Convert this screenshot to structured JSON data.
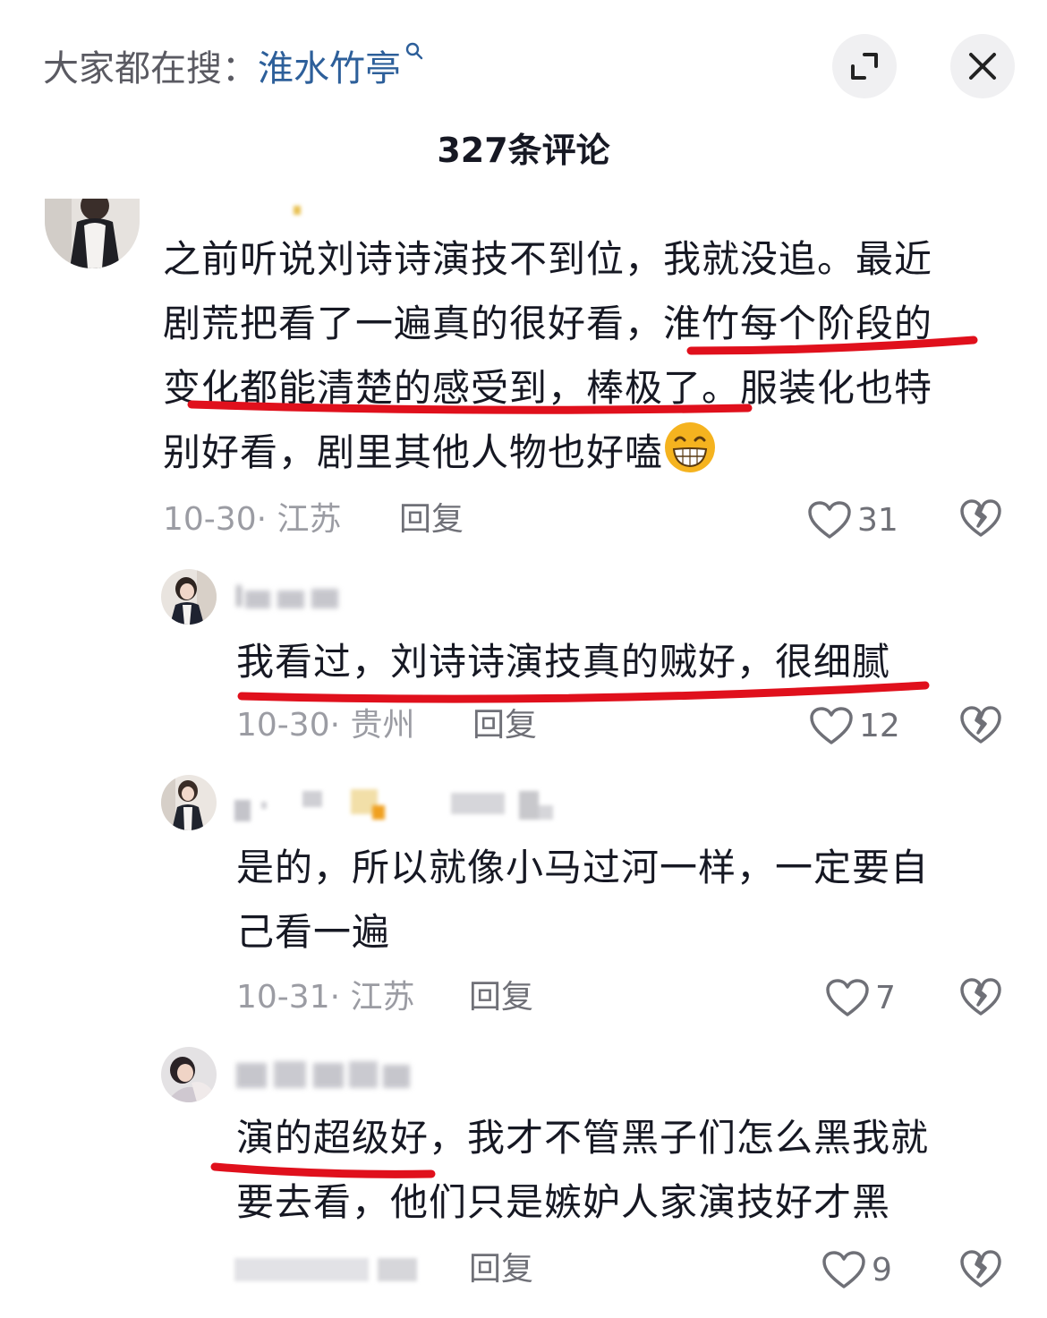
{
  "header": {
    "search_prefix": "大家都在搜：",
    "search_keyword": "淮水竹亭",
    "comment_count": "327条评论"
  },
  "colors": {
    "underline": "#e0101c",
    "keyword": "#2d5f9a",
    "accent_emoji": "#f5b31f"
  },
  "comments": [
    {
      "lines": [
        "之前听说刘诗诗演技不到位，我就没追。最近",
        "剧荒把看了一遍真的很好看，淮竹每个阶段的",
        "变化都能清楚的感受到，棒极了。服装化也特",
        "别好看，剧里其他人物也好嗑"
      ],
      "meta": "10-30· 江苏",
      "reply": "回复",
      "likes": "31"
    },
    {
      "lines": [
        "我看过，刘诗诗演技真的贼好，很细腻"
      ],
      "meta": "10-30· 贵州",
      "reply": "回复",
      "likes": "12"
    },
    {
      "lines": [
        "是的，所以就像小马过河一样，一定要自",
        "己看一遍"
      ],
      "meta": "10-31· 江苏",
      "reply": "回复",
      "likes": "7"
    },
    {
      "lines": [
        "演的超级好，我才不管黑子们怎么黑我就",
        "要去看，他们只是嫉妒人家演技好才黑"
      ],
      "meta": "",
      "reply": "回复",
      "likes": "9"
    }
  ]
}
